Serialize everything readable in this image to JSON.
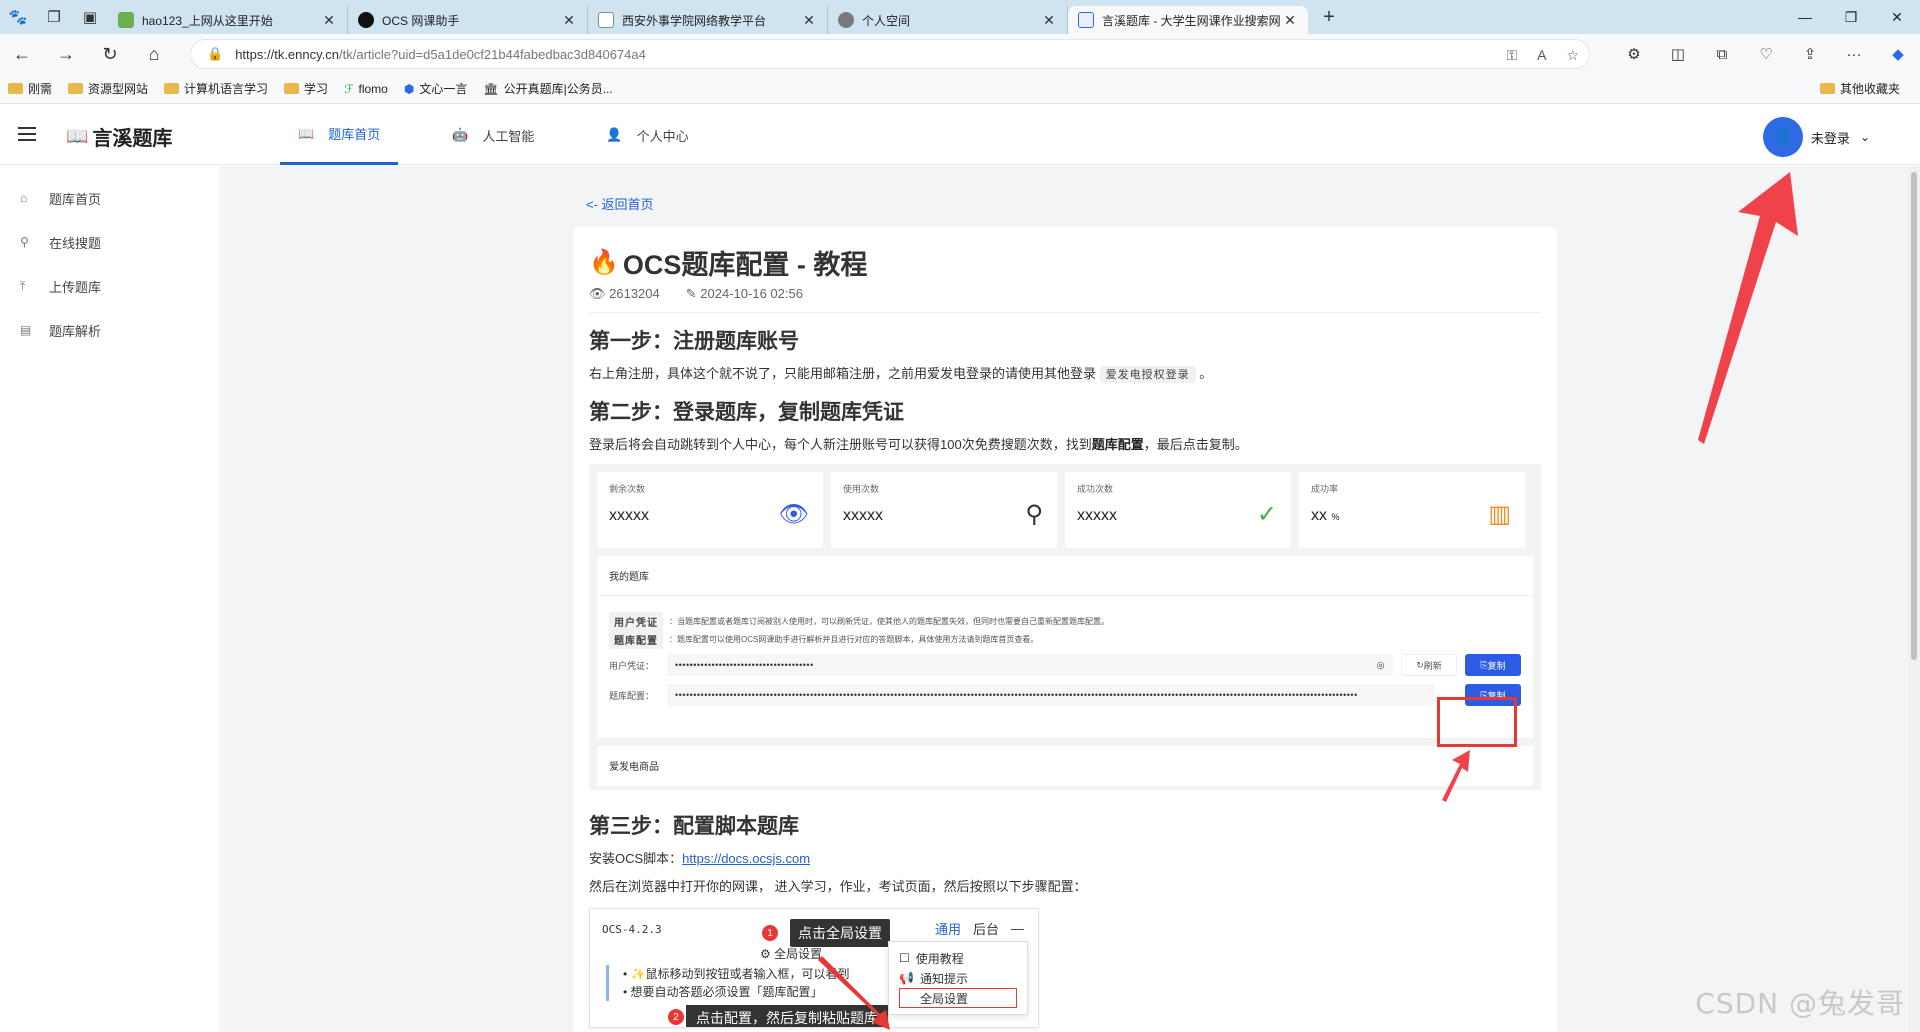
{
  "browser": {
    "tabs": [
      {
        "label": "hao123_上网从这里开始",
        "fav_color": "#6ab04c"
      },
      {
        "label": "OCS 网课助手",
        "fav_color": "#111111"
      },
      {
        "label": "西安外事学院网络教学平台",
        "fav_color": "#ffffff"
      },
      {
        "label": "个人空间",
        "fav_color": "#7a7a7a"
      },
      {
        "label": "言溪题库 - 大学生网课作业搜索网",
        "fav_color": "#2d6ae3"
      }
    ],
    "url_host": "https://tk.enncy.cn",
    "url_path": "/tk/article?uid=d5a1de0cf21b44fabedbac3d840674a4",
    "bookmarks": [
      "刚需",
      "资源型网站",
      "计算机语言学习",
      "学习",
      "flomo",
      "文心一言",
      "公开真题库|公务员..."
    ],
    "other_bookmarks": "其他收藏夹"
  },
  "site": {
    "logo": "言溪题库",
    "nav": [
      {
        "label": "题库首页",
        "icon": "book-icon"
      },
      {
        "label": "人工智能",
        "icon": "robot-icon"
      },
      {
        "label": "个人中心",
        "icon": "person-icon"
      }
    ],
    "user_label": "未登录"
  },
  "sidebar": {
    "items": [
      {
        "label": "题库首页",
        "icon": "home-icon"
      },
      {
        "label": "在线搜题",
        "icon": "search-icon"
      },
      {
        "label": "上传题库",
        "icon": "upload-icon"
      },
      {
        "label": "题库解析",
        "icon": "document-icon"
      }
    ]
  },
  "article": {
    "back_link": "<- 返回首页",
    "title": "OCS题库配置 - 教程",
    "views": "2613204",
    "date": "2024-10-16 02:56",
    "step1_heading": "第一步：注册题库账号",
    "step1_text_a": "右上角注册，具体这个就不说了，只能用邮箱注册，之前用爱发电登录的请使用其他登录",
    "step1_code": "爱发电授权登录",
    "step1_text_b": "。",
    "step2_heading": "第二步：登录题库，复制题库凭证",
    "step2_text_a": "登录后将会自动跳转到个人中心，每个人新注册账号可以获得100次免费搜题次数，找到",
    "step2_bold": "题库配置",
    "step2_text_b": "，最后点击复制。",
    "step3_heading": "第三步：配置脚本题库",
    "step3_install": "安装OCS脚本：",
    "step3_link": "https://docs.ocsjs.com",
    "step3_text": "然后在浏览器中打开你的网课， 进入学习，作业，考试页面，然后按照以下步骤配置："
  },
  "panel": {
    "stats": [
      {
        "label": "剩余次数",
        "value": "xxxxx",
        "icon": "eye-icon",
        "color": "#2d5be3"
      },
      {
        "label": "使用次数",
        "value": "xxxxx",
        "icon": "search-icon",
        "color": "#333333"
      },
      {
        "label": "成功次数",
        "value": "xxxxx",
        "icon": "check-circle-icon",
        "color": "#3cb043"
      },
      {
        "label": "成功率",
        "value": "xx",
        "unit": "%",
        "icon": "bar-chart-icon",
        "color": "#f08c1e"
      }
    ],
    "my_bank": "我的题库",
    "tag1": "用户凭证",
    "tag1_text": "：当题库配置或者题库订阅被别人使用时，可以刷新凭证，使其他人的题库配置失效，但同时也需要自己重新配置题库配置。",
    "tag2": "题库配置",
    "tag2_text": "：题库配置可以使用OCS网课助手进行解析并且进行对应的答题脚本，具体使用方法请到题库首页查看。",
    "field1_label": "用户凭证：",
    "field1_value": "••••••••••••••••••••••••••••••••••••••",
    "refresh_label": "刷新",
    "copy_label": "复制",
    "field2_label": "题库配置：",
    "field2_value": "•••••••••••••••••••••••••••••••••••••••••••••••••••••••••••••••••••••••••••••••••••••••••••••••••••••••••••••••••••••••••••••••••••••••••••••••••••••••••••••••••••••••••••••••••••••••••••",
    "aifadian": "爱发电商品"
  },
  "ocs_shot": {
    "version": "OCS-4.2.3",
    "tab_general": "通用",
    "tab_backend": "后台",
    "tip1_num": "1",
    "tip1": "点击全局设置",
    "gear_label": "全局设置",
    "menu": [
      "使用教程",
      "通知提示",
      "全局设置"
    ],
    "bullet1": "鼠标移动到按钮或者输入框，可以看到",
    "bullet2": "想要自动答题必须设置「题库配置」",
    "tip2_num": "2",
    "tip2": "点击配置，然后复制粘贴题库"
  },
  "watermark": "CSDN @兔发哥",
  "colors": {
    "accent": "#1e62d0",
    "annotation_red": "#e53935"
  }
}
